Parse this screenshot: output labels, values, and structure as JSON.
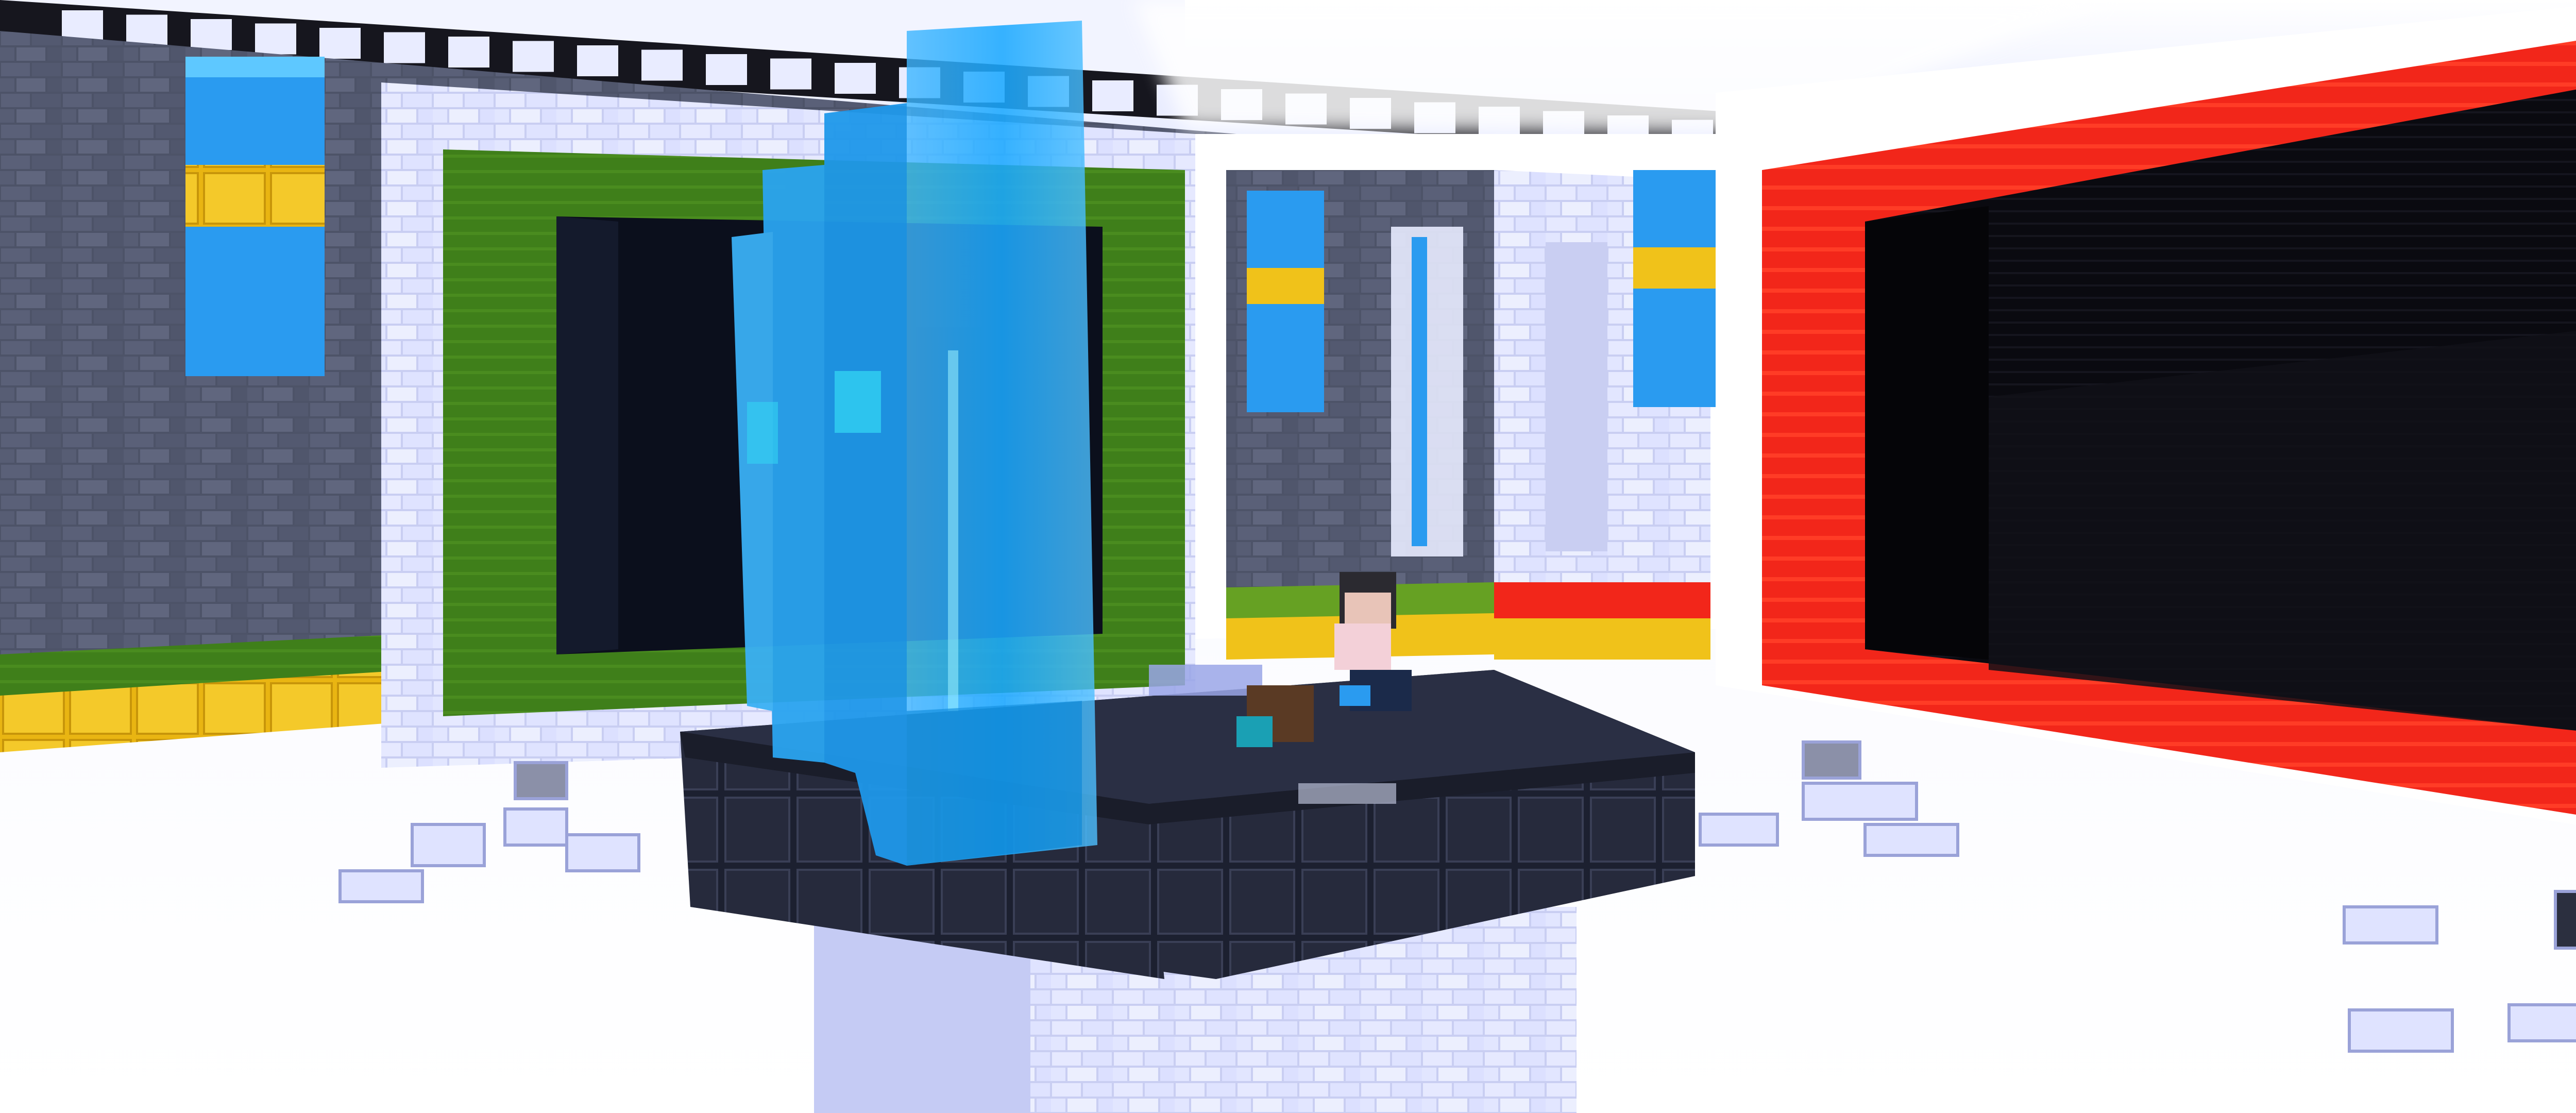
{
  "scene": {
    "kind": "voxel-game-render",
    "hud_visible": false
  },
  "palette": {
    "sky_white": "#ffffff",
    "stone_dark": "#4a5064",
    "stone_light": "#6a6f86",
    "quartz": "#dfe3ff",
    "quartz_shadow": "#b9bff0",
    "green_wool": "#3f7f1a",
    "green_light": "#66a123",
    "yellow_gold": "#f0c21a",
    "blue_wool": "#2a9bf0",
    "blue_light": "#5ec8ff",
    "glass_blue": "#1aa8ff",
    "red_wool": "#ff2a1a",
    "red_dark": "#c0140c",
    "void_black": "#07070c",
    "portal_dark": "#0b0f1c",
    "platform_dark": "#1c2030",
    "platform_edge": "#33384c"
  },
  "elements": {
    "left_wall": "stone-brick-wall",
    "green_doorway": "green-wool-doorway",
    "red_doorway": "red-wool-doorway",
    "crystal": "blue-glass-crystal",
    "platform": "dark-tile-platform",
    "pillar": "quartz-pillar",
    "players": [
      "player-standing",
      "player-lying",
      "player-crouching"
    ]
  }
}
